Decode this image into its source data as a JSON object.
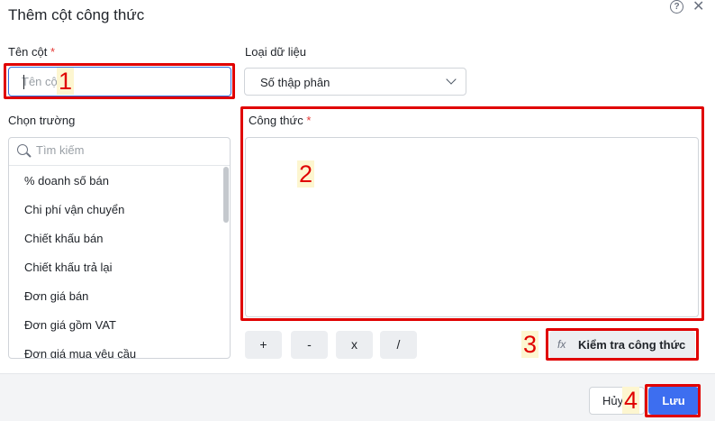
{
  "dialog": {
    "title": "Thêm cột công thức"
  },
  "column_name": {
    "label": "Tên cột",
    "required_mark": "*",
    "placeholder": "Tên cột",
    "value": ""
  },
  "data_type": {
    "label": "Loại dữ liệu",
    "selected": "Số thập phân"
  },
  "field_chooser": {
    "label": "Chọn trường",
    "search_placeholder": "Tìm kiếm",
    "items": [
      "% doanh số bán",
      "Chi phí vận chuyển",
      "Chiết khấu bán",
      "Chiết khấu trả lại",
      "Đơn giá bán",
      "Đơn giá gồm VAT",
      "Đơn giá mua yêu cầu"
    ]
  },
  "formula": {
    "label": "Công thức",
    "required_mark": "*",
    "value": ""
  },
  "operators": [
    "+",
    "-",
    "x",
    "/"
  ],
  "check_button": {
    "icon": "fx",
    "label": "Kiểm tra công thức"
  },
  "footer": {
    "cancel_label": "Hủy",
    "save_label": "Lưu"
  },
  "annotations": {
    "markers": [
      "1",
      "2",
      "3",
      "4"
    ],
    "color": "#e00000"
  },
  "colors": {
    "primary": "#3d6ef0",
    "required": "#e53935",
    "focus_border": "#2f6fe0"
  }
}
